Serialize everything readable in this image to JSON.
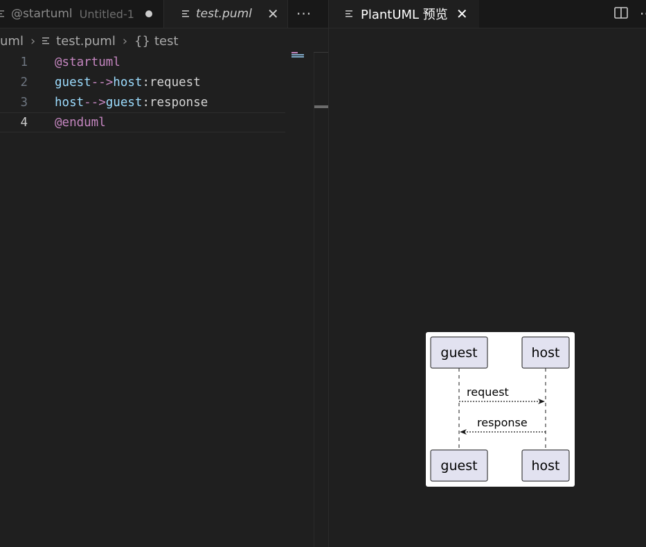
{
  "left_editor": {
    "tabs": [
      {
        "label": "@startuml",
        "sublabel": "Untitled-1",
        "state": "modified"
      },
      {
        "label": "test.puml",
        "state": "active-preview"
      }
    ],
    "more_actions": "···",
    "breadcrumb": {
      "root": "uml",
      "file": "test.puml",
      "symbol_icon": "{}",
      "symbol": "test"
    },
    "lines": [
      {
        "number": "1",
        "tokens": [
          {
            "t": "@startuml",
            "c": "kw"
          }
        ]
      },
      {
        "number": "2",
        "tokens": [
          {
            "t": "guest",
            "c": "id"
          },
          {
            "t": "-->",
            "c": "arrow"
          },
          {
            "t": "host",
            "c": "id"
          },
          {
            "t": ":request",
            "c": "plain"
          }
        ]
      },
      {
        "number": "3",
        "tokens": [
          {
            "t": "host",
            "c": "id"
          },
          {
            "t": "-->",
            "c": "arrow"
          },
          {
            "t": "guest",
            "c": "id"
          },
          {
            "t": ":response",
            "c": "plain"
          }
        ]
      },
      {
        "number": "4",
        "tokens": [
          {
            "t": "@enduml",
            "c": "kw"
          }
        ]
      }
    ],
    "current_line": "4"
  },
  "right_preview": {
    "tab_label": "PlantUML 预览",
    "more_actions": "···",
    "diagram": {
      "participants": [
        "guest",
        "host"
      ],
      "messages": [
        {
          "label": "request",
          "from": "guest",
          "to": "host"
        },
        {
          "label": "response",
          "from": "host",
          "to": "guest"
        }
      ]
    }
  },
  "colors": {
    "editor_bg": "#1f1f1f",
    "tab_bar_bg": "#181818",
    "keyword": "#c586c0",
    "identifier": "#9cdcfe",
    "participant_fill": "#e2e2f0",
    "participant_border": "#181818"
  }
}
